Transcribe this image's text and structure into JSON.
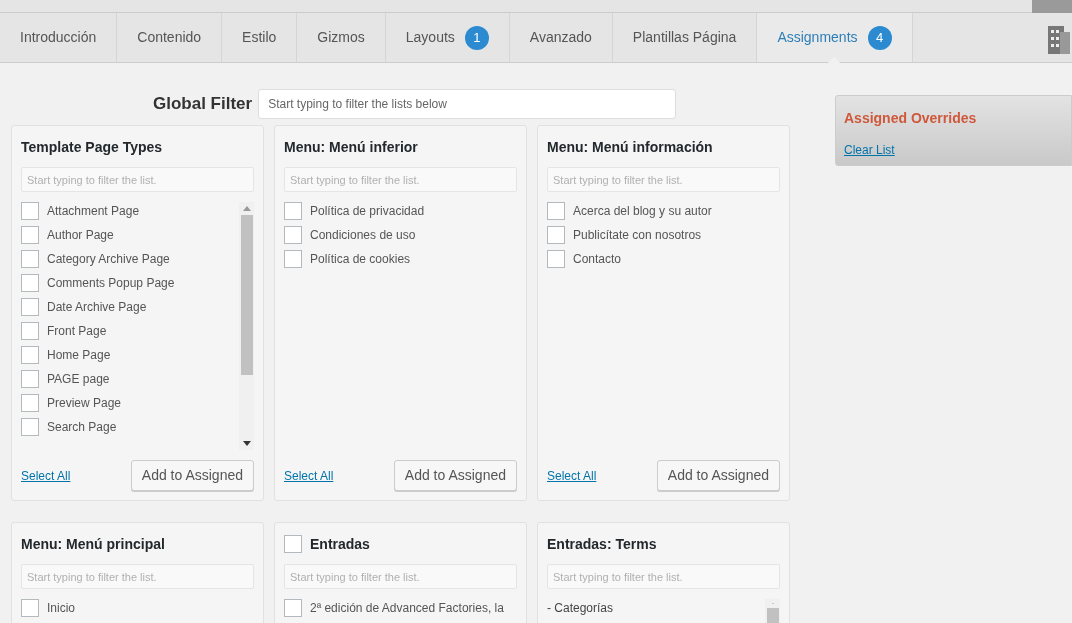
{
  "tabs": [
    {
      "label": "Introducción",
      "selected": false
    },
    {
      "label": "Contenido",
      "selected": false
    },
    {
      "label": "Estilo",
      "selected": false
    },
    {
      "label": "Gizmos",
      "selected": false
    },
    {
      "label": "Layouts",
      "selected": false,
      "badge": "1"
    },
    {
      "label": "Avanzado",
      "selected": false
    },
    {
      "label": "Plantillas Página",
      "selected": false
    },
    {
      "label": "Assignments",
      "selected": true,
      "badge": "4"
    }
  ],
  "global_filter": {
    "label": "Global Filter",
    "placeholder": "Start typing to filter the lists below"
  },
  "panels": [
    {
      "title": "Template Page Types",
      "kind": "scroll_list",
      "placeholder": "Start typing to filter the list.",
      "items": [
        {
          "label": "Attachment Page",
          "checked": false
        },
        {
          "label": "Author Page",
          "checked": false
        },
        {
          "label": "Category Archive Page",
          "checked": false
        },
        {
          "label": "Comments Popup Page",
          "checked": false
        },
        {
          "label": "Date Archive Page",
          "checked": false
        },
        {
          "label": "Front Page",
          "checked": false
        },
        {
          "label": "Home Page",
          "checked": false
        },
        {
          "label": "PAGE page",
          "checked": false
        },
        {
          "label": "Preview Page",
          "checked": false
        },
        {
          "label": "Search Page",
          "checked": false
        }
      ],
      "select_all": "Select All",
      "add_button": "Add to Assigned"
    },
    {
      "title": "Menu: Menú inferior",
      "kind": "list",
      "placeholder": "Start typing to filter the list.",
      "items": [
        {
          "label": "Política de privacidad",
          "checked": false
        },
        {
          "label": "Condiciones de uso",
          "checked": false
        },
        {
          "label": "Política de cookies",
          "checked": false
        }
      ],
      "select_all": "Select All",
      "add_button": "Add to Assigned"
    },
    {
      "title": "Menu: Menú información",
      "kind": "list",
      "placeholder": "Start typing to filter the list.",
      "items": [
        {
          "label": "Acerca del blog y su autor",
          "checked": false
        },
        {
          "label": "Publicítate con nosotros",
          "checked": false
        },
        {
          "label": "Contacto",
          "checked": false
        }
      ],
      "select_all": "Select All",
      "add_button": "Add to Assigned"
    },
    {
      "title": "Menu: Menú principal",
      "kind": "list",
      "placeholder": "Start typing to filter the list.",
      "items": [
        {
          "label": "Inicio",
          "checked": false
        }
      ]
    },
    {
      "title": "Entradas",
      "kind": "list",
      "header_checked": false,
      "placeholder": "Start typing to filter the list.",
      "items": [
        {
          "label": "2ª edición de Advanced Factories, la",
          "checked": false
        }
      ]
    },
    {
      "title": "Entradas: Terms",
      "kind": "scroll_list",
      "placeholder": "Start typing to filter the list.",
      "items": [
        {
          "label": "- Categorías",
          "kind": "group"
        }
      ]
    }
  ],
  "assigned": {
    "title": "Assigned Overrides",
    "clear": "Clear List"
  }
}
